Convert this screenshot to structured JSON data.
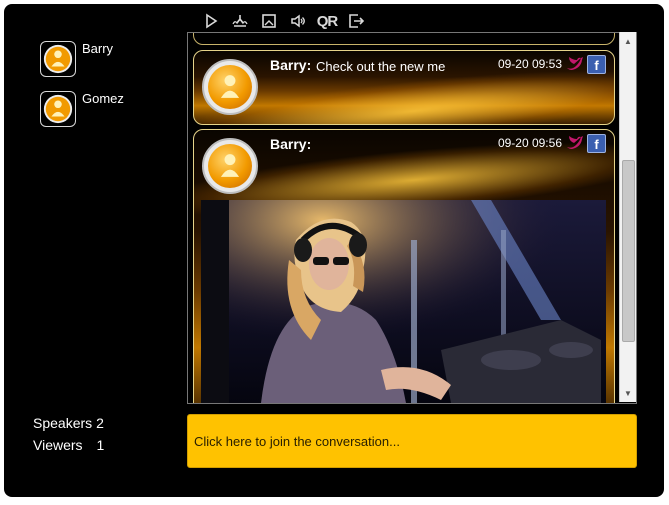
{
  "toolbar": {
    "icons": [
      "play-icon",
      "upload-icon",
      "image-icon",
      "volume-icon",
      "qr-icon",
      "exit-icon"
    ],
    "qr_label": "QR"
  },
  "users": [
    {
      "name": "Barry"
    },
    {
      "name": "Gomez"
    }
  ],
  "stats": {
    "speakers_label": "Speakers",
    "speakers_value": "2",
    "viewers_label": "Viewers",
    "viewers_value": "1"
  },
  "messages": [
    {
      "author": "Barry:",
      "text": "Check out the new me",
      "time": "09-20 09:53"
    },
    {
      "author": "Barry:",
      "text": "",
      "time": "09-20 09:56",
      "has_image": true
    }
  ],
  "join": {
    "label": "Click here to join the conversation..."
  },
  "colors": {
    "accent": "#ffc200",
    "background": "#000000",
    "facebook": "#3b5fb0",
    "twitter": "#c2186b"
  }
}
